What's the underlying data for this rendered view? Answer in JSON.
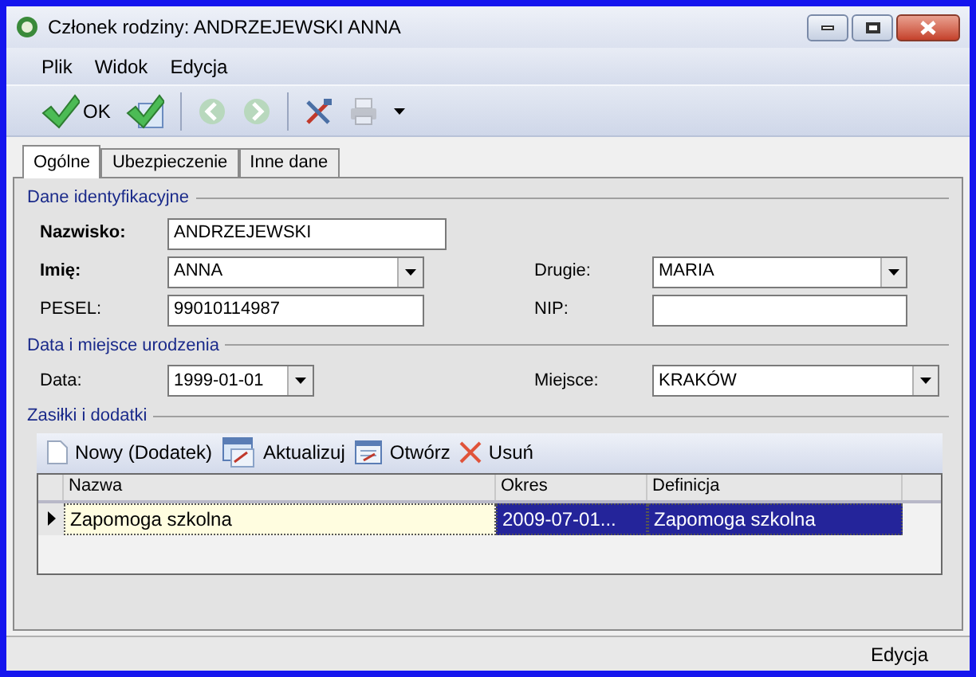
{
  "window": {
    "title": "Członek rodziny: ANDRZEJEWSKI ANNA"
  },
  "menu": [
    "Plik",
    "Widok",
    "Edycja"
  ],
  "toolbar": [
    {
      "kind": "ok",
      "label": "OK",
      "disabled": false
    },
    {
      "kind": "save",
      "disabled": false
    },
    {
      "kind": "separator"
    },
    {
      "kind": "back",
      "disabled": true
    },
    {
      "kind": "forward",
      "disabled": true
    },
    {
      "kind": "separator"
    },
    {
      "kind": "tools",
      "disabled": false
    },
    {
      "kind": "printer",
      "disabled": true
    },
    {
      "kind": "dropdown"
    }
  ],
  "tabs": [
    {
      "label": "Ogólne",
      "selected": true
    },
    {
      "label": "Ubezpieczenie",
      "selected": false
    },
    {
      "label": "Inne dane",
      "selected": false
    }
  ],
  "sections": [
    {
      "title": "Dane identyfikacyjne",
      "rows": [
        [
          {
            "label": "Nazwisko:",
            "bold": true,
            "kind": "text",
            "value": "ANDRZEJEWSKI"
          }
        ],
        [
          {
            "label": "Imię:",
            "bold": true,
            "kind": "combo",
            "value": "ANNA"
          },
          {
            "label": "Drugie:",
            "bold": false,
            "kind": "combo",
            "value": "MARIA"
          }
        ],
        [
          {
            "label": "PESEL:",
            "bold": false,
            "kind": "text",
            "value": "99010114987"
          },
          {
            "label": "NIP:",
            "bold": false,
            "kind": "text"
          }
        ]
      ]
    },
    {
      "title": "Data i miejsce urodzenia",
      "rows": [
        [
          {
            "label": "Data:",
            "bold": false,
            "kind": "date",
            "value": "1999-01-01"
          },
          {
            "label": "Miejsce:",
            "bold": false,
            "kind": "combo",
            "value": "KRAKÓW"
          }
        ]
      ]
    }
  ],
  "benefits": {
    "title": "Zasiłki i dodatki",
    "toolbar": [
      {
        "kind": "new",
        "label": "Nowy (Dodatek)"
      },
      {
        "kind": "update",
        "label": "Aktualizuj"
      },
      {
        "kind": "open",
        "label": "Otwórz"
      },
      {
        "kind": "delete",
        "label": "Usuń"
      }
    ],
    "columns": [
      "Nazwa",
      "Okres",
      "Definicja"
    ],
    "rows": [
      {
        "selected": true,
        "cells": [
          {
            "text": "Zapomoga szkolna",
            "focused": true
          },
          {
            "text": "2009-07-01...",
            "focused": false
          },
          {
            "text": "Zapomoga szkolna",
            "focused": false
          }
        ]
      }
    ]
  },
  "status_bar": "Edycja"
}
